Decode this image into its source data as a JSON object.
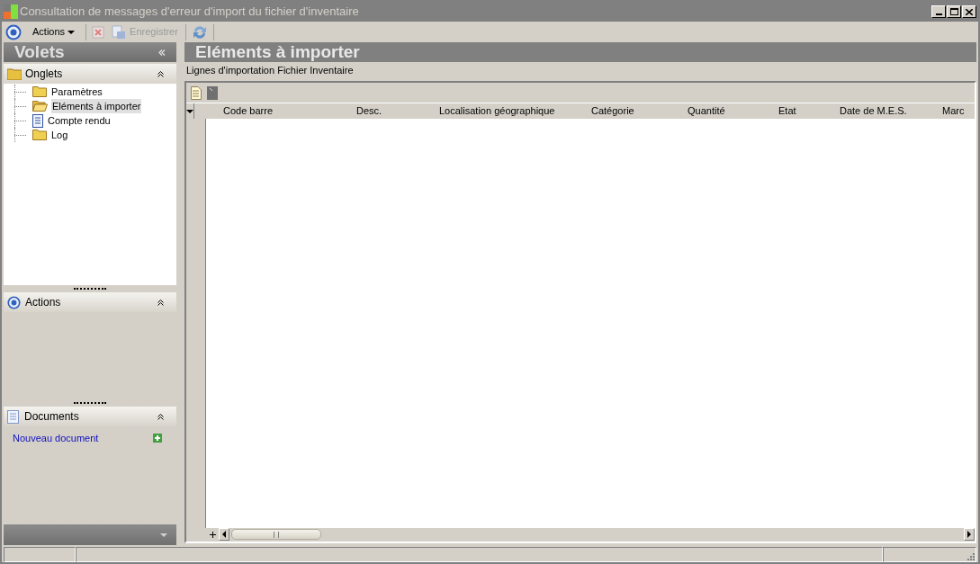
{
  "window": {
    "title": "Consultation de messages d'erreur d'import du fichier d'inventaire"
  },
  "toolbar": {
    "actions_menu": "Actions",
    "save_button": "Enregistrer"
  },
  "sidebar": {
    "title": "Volets",
    "tabs_panel": {
      "title": "Onglets",
      "items": [
        {
          "label": "Paramètres",
          "kind": "folder",
          "selected": false
        },
        {
          "label": "Eléments à importer",
          "kind": "open-folder",
          "selected": true
        },
        {
          "label": "Compte rendu",
          "kind": "document",
          "selected": false
        },
        {
          "label": "Log",
          "kind": "folder",
          "selected": false
        }
      ]
    },
    "actions_panel": {
      "title": "Actions"
    },
    "documents_panel": {
      "title": "Documents",
      "link": "Nouveau document"
    }
  },
  "main": {
    "title": "Eléments à importer",
    "subtitle": "Lignes d'importation Fichier Inventaire",
    "table": {
      "columns": [
        {
          "label": "Code barre"
        },
        {
          "label": "Desc."
        },
        {
          "label": "Localisation géographique"
        },
        {
          "label": "Catégorie"
        },
        {
          "label": "Quantité"
        },
        {
          "label": "Etat"
        },
        {
          "label": "Date de M.E.S."
        },
        {
          "label": "Marc"
        }
      ]
    }
  }
}
